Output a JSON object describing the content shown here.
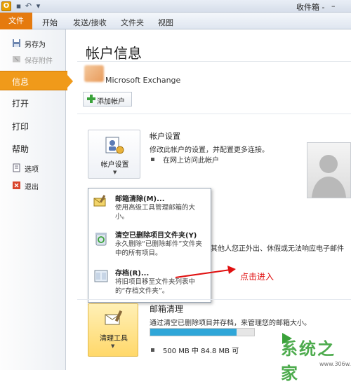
{
  "window": {
    "title": "收件箱 -"
  },
  "ribbon": {
    "tabs": [
      "文件",
      "开始",
      "发送/接收",
      "文件夹",
      "视图"
    ]
  },
  "nav": {
    "save_as": "另存为",
    "save_attachments": "保存附件",
    "info": "信息",
    "open": "打开",
    "print": "打印",
    "help": "帮助",
    "options": "选项",
    "exit": "退出"
  },
  "main": {
    "title": "帐户信息",
    "account_type": "Microsoft Exchange",
    "add_account": "添加帐户",
    "account_settings": {
      "button": "帐户设置",
      "title": "帐户设置",
      "desc": "修改此帐户的设置，并配置更多连接。",
      "link": "在网上访问此帐户"
    },
    "behind_text": "其他人您正外出、休假或无法响应电子邮件",
    "dropdown": [
      {
        "title": "邮箱清除(M)...",
        "desc": "使用高级工具管理邮箱的大小。"
      },
      {
        "title": "清空已删除项目文件夹(Y)",
        "desc": "永久删除“已删除邮件”文件夹中的所有项目。"
      },
      {
        "title": "存档(R)...",
        "desc": "将旧项目移至文件夹列表中的“存档文件夹”。"
      }
    ],
    "annotation": "点击进入",
    "mailbox": {
      "button": "清理工具",
      "title": "邮箱清理",
      "desc": "通过清空已删除项目并存档，来管理您的邮箱大小。",
      "quota_text": "500 MB 中 84.8 MB 可",
      "quota_used_fraction": 0.83
    }
  },
  "watermark": {
    "text": "系统之家",
    "sub": "www.306w.com"
  },
  "colors": {
    "accent": "#e57a0e",
    "nav_selected": "#f09a1a",
    "annotation": "#e01010",
    "quota_fill": "#2fa6d8"
  }
}
